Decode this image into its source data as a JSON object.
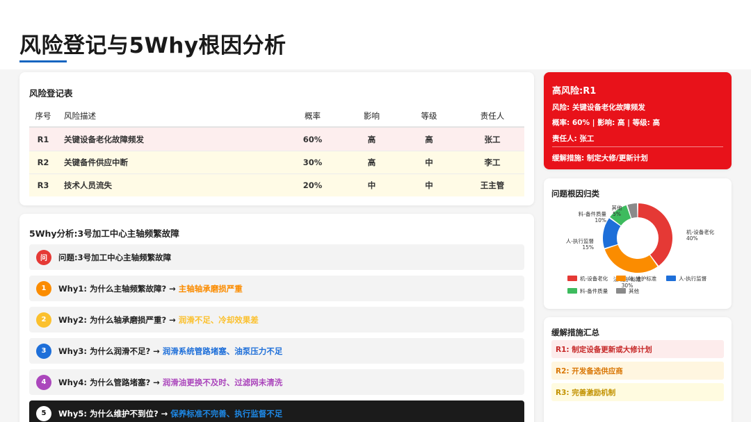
{
  "page": {
    "title": "风险登记与5Why根因分析"
  },
  "colors": {
    "accent": "#1565c0",
    "high_risk": "#e8121a"
  },
  "risk_register": {
    "title": "风险登记表",
    "columns": [
      "序号",
      "风险描述",
      "概率",
      "影响",
      "等级",
      "责任人"
    ],
    "rows": [
      {
        "id": "R1",
        "desc": "关键设备老化故障频发",
        "prob": "60%",
        "impact": "高",
        "level": "高",
        "owner": "张工"
      },
      {
        "id": "R2",
        "desc": "关键备件供应中断",
        "prob": "30%",
        "impact": "高",
        "level": "中",
        "owner": "李工"
      },
      {
        "id": "R3",
        "desc": "技术人员流失",
        "prob": "20%",
        "impact": "中",
        "level": "中",
        "owner": "王主管"
      }
    ]
  },
  "five_why": {
    "title": "5Why分析:3号加工中心主轴频繁故障",
    "items": [
      {
        "badge": "问",
        "color": "#e53935",
        "question": "问题:3号加工中心主轴频繁故障",
        "answer": ""
      },
      {
        "badge": "1",
        "color": "#fb8c00",
        "question": "Why1: 为什么主轴频繁故障?",
        "answer": "主轴轴承磨损严重"
      },
      {
        "badge": "2",
        "color": "#fbc02d",
        "question": "Why2: 为什么轴承磨损严重?",
        "answer": "润滑不足、冷却效果差"
      },
      {
        "badge": "3",
        "color": "#1e6fd9",
        "question": "Why3: 为什么润滑不足?",
        "answer": "润滑系统管路堵塞、油泵压力不足"
      },
      {
        "badge": "4",
        "color": "#ab47bc",
        "question": "Why4: 为什么管路堵塞?",
        "answer": "润滑油更换不及时、过滤网未清洗"
      },
      {
        "badge": "5",
        "color": "#1e88e5",
        "question": "Why5: 为什么维护不到位?",
        "answer": "保养标准不完善、执行监督不足"
      }
    ],
    "arrow": "→"
  },
  "high_risk": {
    "title": "高风险:R1",
    "risk": "风险: 关键设备老化故障频发",
    "metrics": "概率: 60% | 影响: 高 | 等级: 高",
    "owner": "责任人: 张工",
    "mitigation": "缓解措施: 制定大修/更新计划"
  },
  "root_cause": {
    "title": "问题根因归类",
    "chart_data": {
      "type": "pie",
      "categories": [
        "机-设备老化",
        "法-维护标准",
        "人-执行监督",
        "料-备件质量",
        "其他"
      ],
      "values": [
        40,
        30,
        15,
        10,
        5
      ],
      "value_labels": [
        "40%",
        "30%",
        "15%",
        "10%",
        "5%"
      ],
      "colors": [
        "#e53935",
        "#fb8c00",
        "#1e6fd9",
        "#3dbb5e",
        "#8a8a8a"
      ],
      "legend": "bottom"
    }
  },
  "mitigation": {
    "title": "缓解措施汇总",
    "items": [
      {
        "text": "R1: 制定设备更新或大修计划",
        "bg": "#fdecec",
        "fg": "#c62828"
      },
      {
        "text": "R2: 开发备选供应商",
        "bg": "#fff6e0",
        "fg": "#d97706"
      },
      {
        "text": "R3: 完善激励机制",
        "bg": "#fffbe0",
        "fg": "#c29200"
      }
    ]
  }
}
